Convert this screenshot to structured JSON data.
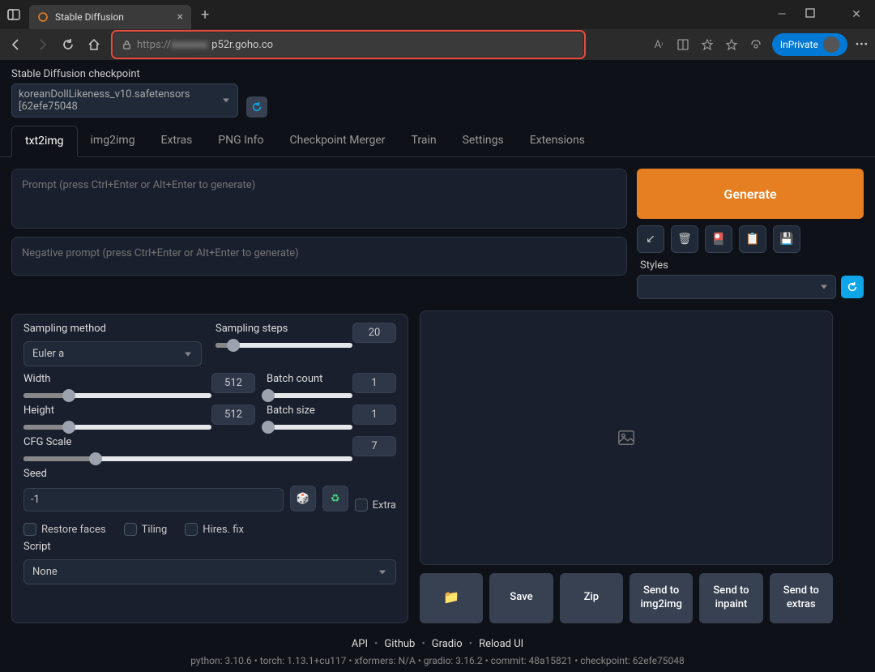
{
  "browser": {
    "tab_title": "Stable Diffusion",
    "url_prefix": "https://",
    "url_visible": "p52r.goho.co",
    "inprivate_label": "InPrivate"
  },
  "checkpoint": {
    "label": "Stable Diffusion checkpoint",
    "value": "koreanDollLikeness_v10.safetensors [62efe75048"
  },
  "tabs": [
    "txt2img",
    "img2img",
    "Extras",
    "PNG Info",
    "Checkpoint Merger",
    "Train",
    "Settings",
    "Extensions"
  ],
  "active_tab_index": 0,
  "prompt": {
    "placeholder": "Prompt (press Ctrl+Enter or Alt+Enter to generate)",
    "negative_placeholder": "Negative prompt (press Ctrl+Enter or Alt+Enter to generate)"
  },
  "generate_label": "Generate",
  "toolbar_icons": [
    "↙",
    "🗑",
    "🎴",
    "📋",
    "💾"
  ],
  "styles_label": "Styles",
  "params": {
    "sampling_method": {
      "label": "Sampling method",
      "value": "Euler a"
    },
    "sampling_steps": {
      "label": "Sampling steps",
      "value": "20",
      "pct": 13
    },
    "width": {
      "label": "Width",
      "value": "512",
      "pct": 24
    },
    "height": {
      "label": "Height",
      "value": "512",
      "pct": 24
    },
    "batch_count": {
      "label": "Batch count",
      "value": "1",
      "pct": 2
    },
    "batch_size": {
      "label": "Batch size",
      "value": "1",
      "pct": 2
    },
    "cfg_scale": {
      "label": "CFG Scale",
      "value": "7",
      "pct": 22
    },
    "seed": {
      "label": "Seed",
      "value": "-1"
    },
    "extra_label": "Extra",
    "checkboxes": [
      "Restore faces",
      "Tiling",
      "Hires. fix"
    ],
    "script": {
      "label": "Script",
      "value": "None"
    }
  },
  "output_actions": {
    "save": "Save",
    "zip": "Zip",
    "img2img": "Send to img2img",
    "inpaint": "Send to inpaint",
    "extras": "Send to extras"
  },
  "footer": {
    "links": [
      "API",
      "Github",
      "Gradio",
      "Reload UI"
    ],
    "versions": "python: 3.10.6  •  torch: 1.13.1+cu117  •  xformers: N/A  •  gradio: 3.16.2  •  commit: 48a15821  •  checkpoint: 62efe75048"
  }
}
